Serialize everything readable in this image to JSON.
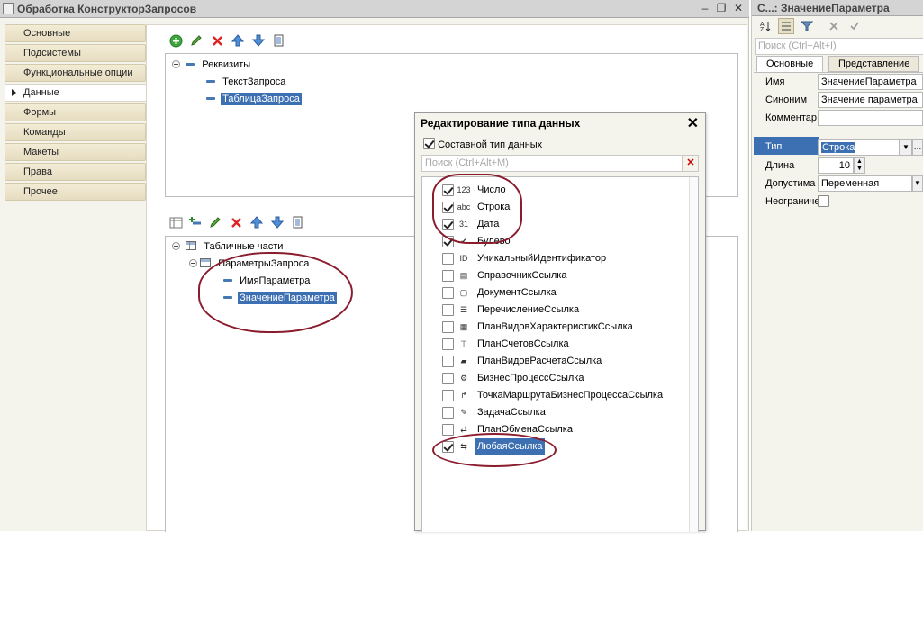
{
  "window": {
    "title": "Обработка КонструкторЗапросов"
  },
  "nav": [
    {
      "label": "Основные",
      "active": false
    },
    {
      "label": "Подсистемы",
      "active": false
    },
    {
      "label": "Функциональные опции",
      "active": false
    },
    {
      "label": "Данные",
      "active": true
    },
    {
      "label": "Формы",
      "active": false
    },
    {
      "label": "Команды",
      "active": false
    },
    {
      "label": "Макеты",
      "active": false
    },
    {
      "label": "Права",
      "active": false
    },
    {
      "label": "Прочее",
      "active": false
    }
  ],
  "attributes_tree": {
    "root": "Реквизиты",
    "items": [
      "ТекстЗапроса",
      "ТаблицаЗапроса"
    ],
    "selected": "ТаблицаЗапроса"
  },
  "tabular_tree": {
    "root": "Табличные части",
    "table": "ПараметрыЗапроса",
    "items": [
      "ИмяПараметра",
      "ЗначениеПараметра"
    ],
    "selected": "ЗначениеПараметра"
  },
  "dialog": {
    "title": "Редактирование типа данных",
    "composite_label": "Составной тип данных",
    "composite_checked": true,
    "search_placeholder": "Поиск (Ctrl+Alt+M)",
    "types": [
      {
        "label": "Число",
        "checked": true,
        "icon": "number-icon",
        "glyph": "123"
      },
      {
        "label": "Строка",
        "checked": true,
        "icon": "string-icon",
        "glyph": "abc"
      },
      {
        "label": "Дата",
        "checked": true,
        "icon": "calendar-icon",
        "glyph": "31"
      },
      {
        "label": "Булево",
        "checked": true,
        "icon": "boolean-icon",
        "glyph": "✔"
      },
      {
        "label": "УникальныйИдентификатор",
        "checked": false,
        "icon": "id-icon",
        "glyph": "ID"
      },
      {
        "label": "СправочникСсылка",
        "checked": false,
        "icon": "catalog-icon",
        "glyph": "▤"
      },
      {
        "label": "ДокументСсылка",
        "checked": false,
        "icon": "document-icon",
        "glyph": "▢"
      },
      {
        "label": "ПеречислениеСсылка",
        "checked": false,
        "icon": "enum-icon",
        "glyph": "☰"
      },
      {
        "label": "ПланВидовХарактеристикСсылка",
        "checked": false,
        "icon": "chart-of-characteristics-icon",
        "glyph": "▦"
      },
      {
        "label": "ПланСчетовСсылка",
        "checked": false,
        "icon": "chart-of-accounts-icon",
        "glyph": "⊤"
      },
      {
        "label": "ПланВидовРасчетаСсылка",
        "checked": false,
        "icon": "calculation-types-icon",
        "glyph": "▰"
      },
      {
        "label": "БизнесПроцессСсылка",
        "checked": false,
        "icon": "business-process-icon",
        "glyph": "⚙"
      },
      {
        "label": "ТочкаМаршрутаБизнесПроцессаСсылка",
        "checked": false,
        "icon": "route-point-icon",
        "glyph": "↱"
      },
      {
        "label": "ЗадачаСсылка",
        "checked": false,
        "icon": "task-icon",
        "glyph": "✎"
      },
      {
        "label": "ПланОбменаСсылка",
        "checked": false,
        "icon": "exchange-plan-icon",
        "glyph": "⇄"
      },
      {
        "label": "ЛюбаяСсылка",
        "checked": true,
        "icon": "any-ref-icon",
        "glyph": "⇆",
        "selected": true
      }
    ]
  },
  "props": {
    "title": "С...: ЗначениеПараметра",
    "search_placeholder": "Поиск (Ctrl+Alt+I)",
    "tabs": [
      "Основные",
      "Представление"
    ],
    "rows": {
      "name_label": "Имя",
      "name_value": "ЗначениеПараметра",
      "synonym_label": "Синоним",
      "synonym_value": "Значение параметра",
      "comment_label": "Комментар",
      "comment_value": "",
      "type_label": "Тип",
      "type_value": "Строка",
      "length_label": "Длина",
      "length_value": "10",
      "allowed_label": "Допустима",
      "allowed_value": "Переменная",
      "unlimited_label": "Неограниче"
    }
  }
}
